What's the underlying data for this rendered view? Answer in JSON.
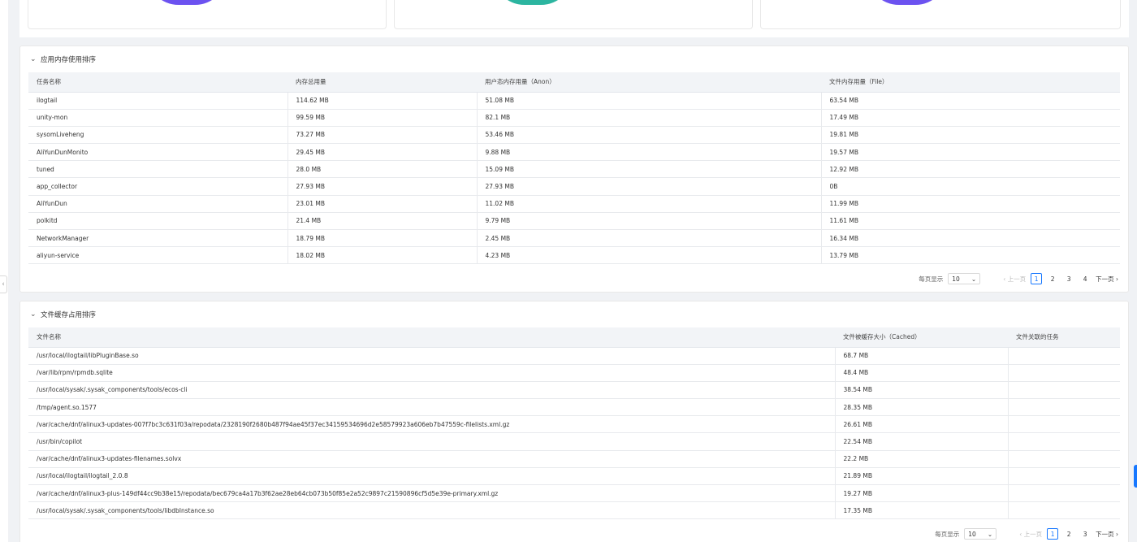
{
  "colors": {
    "arc_purple": "#6c52f0",
    "arc_teal": "#2cb5a0",
    "accent_blue": "#1677ff",
    "header_bg": "#f2f4f7"
  },
  "memory_section": {
    "title": "应用内存使用排序",
    "columns": [
      "任务名称",
      "内存总用量",
      "用户态内存用量（Anon）",
      "文件内存用量（File）"
    ],
    "rows": [
      [
        "ilogtail",
        "114.62 MB",
        "51.08 MB",
        "63.54 MB"
      ],
      [
        "unity-mon",
        "99.59 MB",
        "82.1 MB",
        "17.49 MB"
      ],
      [
        "sysomLiveheng",
        "73.27 MB",
        "53.46 MB",
        "19.81 MB"
      ],
      [
        "AliYunDunMonito",
        "29.45 MB",
        "9.88 MB",
        "19.57 MB"
      ],
      [
        "tuned",
        "28.0 MB",
        "15.09 MB",
        "12.92 MB"
      ],
      [
        "app_collector",
        "27.93 MB",
        "27.93 MB",
        "0B"
      ],
      [
        "AliYunDun",
        "23.01 MB",
        "11.02 MB",
        "11.99 MB"
      ],
      [
        "polkitd",
        "21.4 MB",
        "9.79 MB",
        "11.61 MB"
      ],
      [
        "NetworkManager",
        "18.79 MB",
        "2.45 MB",
        "16.34 MB"
      ],
      [
        "aliyun-service",
        "18.02 MB",
        "4.23 MB",
        "13.79 MB"
      ]
    ],
    "pager": {
      "page_size_label": "每页显示",
      "page_size": "10",
      "prev": "上一页",
      "next": "下一页",
      "pages": [
        "1",
        "2",
        "3",
        "4"
      ],
      "current": "1"
    }
  },
  "file_section": {
    "title": "文件缓存占用排序",
    "columns": [
      "文件名称",
      "文件被缓存大小（Cached）",
      "文件关联的任务"
    ],
    "rows": [
      [
        "/usr/local/ilogtail/libPluginBase.so",
        "68.7 MB",
        ""
      ],
      [
        "/var/lib/rpm/rpmdb.sqlite",
        "48.4 MB",
        ""
      ],
      [
        "/usr/local/sysak/.sysak_components/tools/ecos-cli",
        "38.54 MB",
        ""
      ],
      [
        "/tmp/agent.so.1577",
        "28.35 MB",
        ""
      ],
      [
        "/var/cache/dnf/alinux3-updates-007f7bc3c631f03a/repodata/2328190f2680b487f94ae45f37ec34159534696d2e58579923a606eb7b47559c-filelists.xml.gz",
        "26.61 MB",
        ""
      ],
      [
        "/usr/bin/copilot",
        "22.54 MB",
        ""
      ],
      [
        "/var/cache/dnf/alinux3-updates-filenames.solvx",
        "22.2 MB",
        ""
      ],
      [
        "/usr/local/ilogtail/ilogtail_2.0.8",
        "21.89 MB",
        ""
      ],
      [
        "/var/cache/dnf/alinux3-plus-149df44cc9b38e15/repodata/bec679ca4a17b3f62ae28eb64cb073b50f85e2a52c9897c21590896cf5d5e39e-primary.xml.gz",
        "19.27 MB",
        ""
      ],
      [
        "/usr/local/sysak/.sysak_components/tools/libdbInstance.so",
        "17.35 MB",
        ""
      ]
    ],
    "pager": {
      "page_size_label": "每页显示",
      "page_size": "10",
      "prev": "上一页",
      "next": "下一页",
      "pages": [
        "1",
        "2",
        "3"
      ],
      "current": "1"
    }
  }
}
